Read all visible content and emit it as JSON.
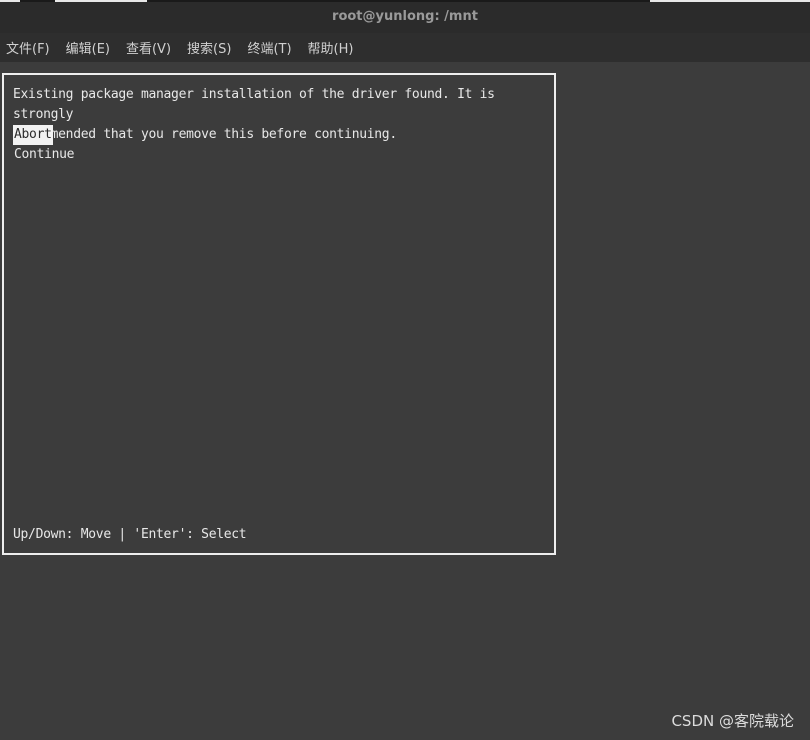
{
  "window": {
    "title": "root@yunlong: /mnt"
  },
  "menubar": {
    "items": [
      {
        "label": "文件(F)"
      },
      {
        "label": "编辑(E)"
      },
      {
        "label": "查看(V)"
      },
      {
        "label": "搜索(S)"
      },
      {
        "label": "终端(T)"
      },
      {
        "label": "帮助(H)"
      }
    ]
  },
  "dialog": {
    "message": "Existing package manager installation of the driver found. It is strongly\nrecommended that you remove this before continuing.",
    "options": [
      {
        "label": "Abort",
        "selected": true
      },
      {
        "label": "Continue",
        "selected": false
      }
    ],
    "footer": "Up/Down: Move | 'Enter': Select"
  },
  "watermark": "CSDN @客院载论"
}
